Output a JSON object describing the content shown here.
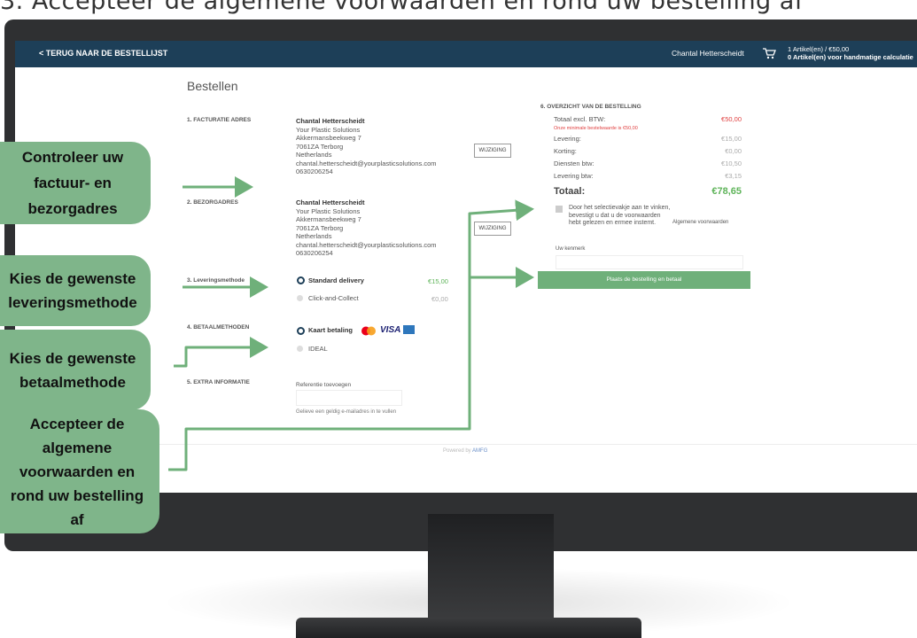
{
  "caption": "3. Accepteer de algemene voorwaarden en rond uw bestelling af",
  "navbar": {
    "back_link": "< TERUG NAAR DE BESTELLIJST",
    "user_name": "Chantal Hetterscheidt",
    "cart_line1": "1 Artikel(en) / €50,00",
    "cart_line2": "0 Artikel(en) voor handmatige calculatie"
  },
  "page_title": "Bestellen",
  "sections": {
    "billing_label": "1. FACTURATIE ADRES",
    "shipping_label": "2. BEZORGADRES",
    "delivery_label": "3. Leveringsmethode",
    "payment_label": "4. BETAALMETHODEN",
    "extra_label": "5. EXTRA INFORMATIE"
  },
  "billing_address": {
    "name": "Chantal Hetterscheidt",
    "company": "Your Plastic Solutions",
    "street": "Akkermansbeekweg 7",
    "city": "7061ZA Terborg",
    "country": "Netherlands",
    "email": "chantal.hetterscheidt@yourplasticsolutions.com",
    "phone": "0630206254"
  },
  "shipping_address": {
    "name": "Chantal Hetterscheidt",
    "company": "Your Plastic Solutions",
    "street": "Akkermansbeekweg 7",
    "city": "7061ZA Terborg",
    "country": "Netherlands",
    "email": "chantal.hetterscheidt@yourplasticsolutions.com",
    "phone": "0630206254"
  },
  "edit_label": "WIJZIGING",
  "delivery": {
    "opt1": "Standard delivery",
    "opt1_price": "€15,00",
    "opt2": "Click-and-Collect",
    "opt2_price": "€0,00"
  },
  "payment": {
    "opt1": "Kaart betaling",
    "visa": "VISA",
    "opt2": "IDEAL"
  },
  "extra": {
    "ref_label": "Referentie toevoegen",
    "email_note": "Gelieve een geldig e-mailadres in te vullen"
  },
  "summary": {
    "title": "6. OVERZICHT VAN DE BESTELLING",
    "excl_label": "Totaal excl. BTW:",
    "excl_value": "€50,00",
    "min_warning": "Onze minimale bestelwaarde is €50,00",
    "levering_label": "Levering:",
    "levering_value": "€15,00",
    "korting_label": "Korting:",
    "korting_value": "€0,00",
    "diensten_label": "Diensten btw:",
    "diensten_value": "€10,50",
    "leverbtw_label": "Levering btw:",
    "leverbtw_value": "€3,15",
    "total_label": "Totaal:",
    "total_value": "€78,65",
    "terms_text": "Door het selectievakje aan te vinken, bevestigt u dat u de voorwaarden hebt gelezen en ermee instemt.",
    "terms_link": "Algemene voorwaarden",
    "kenmerk_label": "Uw kenmerk",
    "place_button": "Plaats de bestelling en betaal"
  },
  "footer": {
    "powered_prefix": "Powered by",
    "powered_brand": "AMFG"
  },
  "callouts": {
    "c1": "Controleer uw factuur- en bezorgadres",
    "c2": "Kies de gewenste leveringsmethode",
    "c3": "Kies de gewenste betaalmethode",
    "c4": "Accepteer de algemene voorwaarden en rond uw bestelling af"
  },
  "colors": {
    "navbar": "#1d3f58",
    "accent_green": "#6fb07a",
    "callout": "#7fb58a",
    "price_red": "#e04040"
  }
}
